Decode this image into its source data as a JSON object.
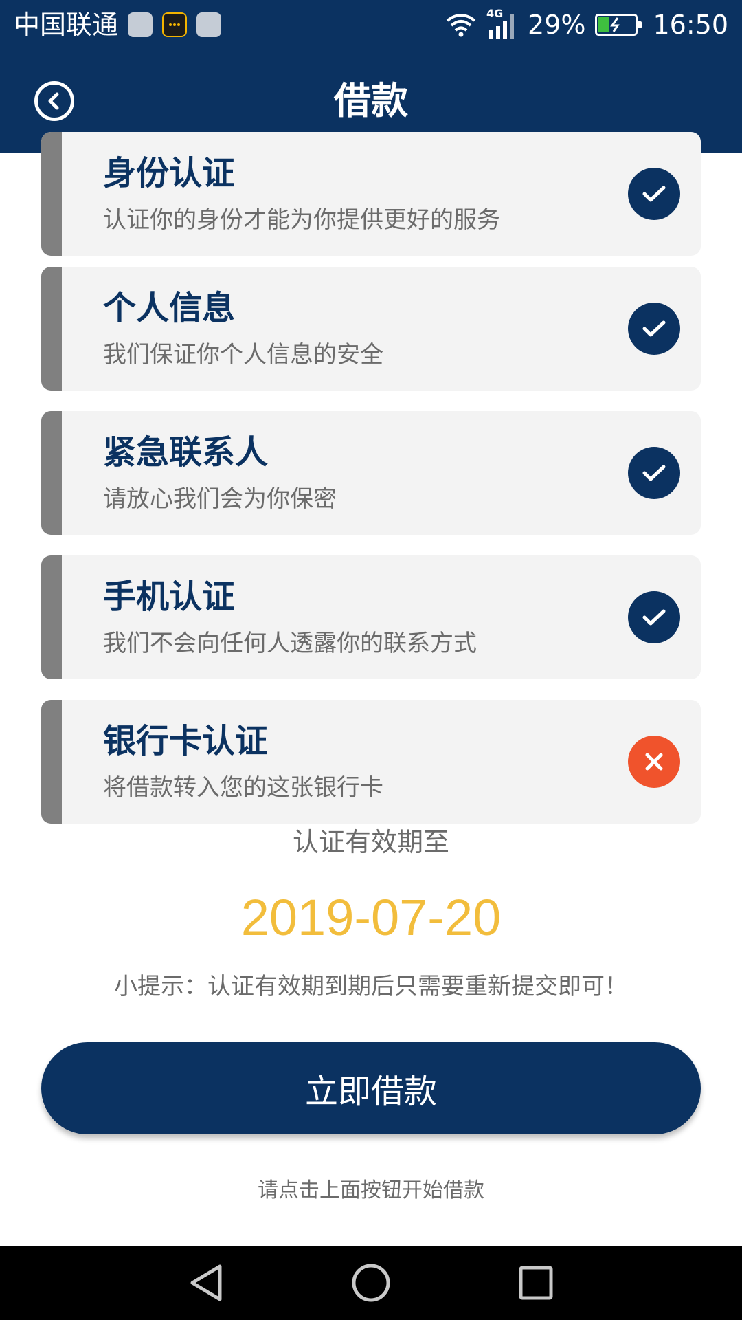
{
  "status_bar": {
    "carrier": "中国联通",
    "network": "4G",
    "battery_percent": "29%",
    "battery_level": 0.29,
    "time": "16:50",
    "icons": [
      "notification-app-icon",
      "messenger-icon",
      "notification-app-icon",
      "wifi-icon",
      "signal-icon",
      "battery-charging-icon"
    ]
  },
  "header": {
    "title": "借款",
    "back_icon": "back-arrow-circle-icon"
  },
  "verifications": [
    {
      "title": "身份认证",
      "description": "认证你的身份才能为你提供更好的服务",
      "status": "verified",
      "icon": "check-icon"
    },
    {
      "title": "个人信息",
      "description": "我们保证你个人信息的安全",
      "status": "verified",
      "icon": "check-icon"
    },
    {
      "title": "紧急联系人",
      "description": "请放心我们会为你保密",
      "status": "verified",
      "icon": "check-icon"
    },
    {
      "title": "手机认证",
      "description": "我们不会向任何人透露你的联系方式",
      "status": "verified",
      "icon": "check-icon"
    },
    {
      "title": "银行卡认证",
      "description": "将借款转入您的这张银行卡",
      "status": "unverified",
      "icon": "close-icon"
    }
  ],
  "validity": {
    "label": "认证有效期至",
    "date": "2019-07-20",
    "tip": "小提示：认证有效期到期后只需要重新提交即可！"
  },
  "action": {
    "button_label": "立即借款",
    "hint": "请点击上面按钮开始借款"
  },
  "colors": {
    "primary": "#0b3261",
    "date_accent": "#f2bd3c",
    "error": "#f0532c",
    "card_bg": "#f3f3f3",
    "card_accent": "#808080"
  },
  "nav_icons": [
    "back-triangle-icon",
    "home-circle-icon",
    "recents-square-icon"
  ]
}
